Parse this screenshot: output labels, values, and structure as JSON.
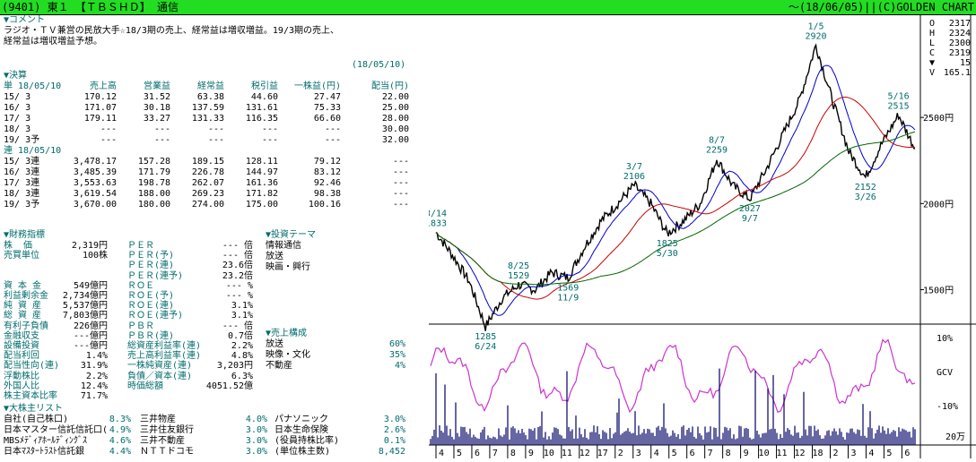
{
  "header": {
    "left": "(9401) 東１ 【ＴＢＳＨＤ】 通信",
    "right": "～(18/06/05)||(C)GOLDEN CHART"
  },
  "comment": {
    "title": "▼コメント",
    "text": [
      "ラジオ・ＴＶ兼営の民放大手☆18/3期の売上、経常益は増収増益。19/3期の売上、",
      "経常益は増収増益予想。"
    ],
    "date": "(18/05/10)"
  },
  "settlement": {
    "title": "▼決算",
    "header": [
      "単 18/05/10",
      "売上高",
      "営業益",
      "経常益",
      "税引益",
      "一株益(円)",
      "配当(円)"
    ],
    "rows": [
      [
        "15/ 3",
        "170.12",
        "31.52",
        "63.38",
        "44.60",
        "27.47",
        "22.00"
      ],
      [
        "16/ 3",
        "171.07",
        "30.18",
        "137.59",
        "131.61",
        "75.33",
        "25.00"
      ],
      [
        "17/ 3",
        "179.11",
        "33.27",
        "131.33",
        "116.35",
        "66.60",
        "28.00"
      ],
      [
        "18/ 3",
        "---",
        "---",
        "---",
        "---",
        "---",
        "30.00"
      ],
      [
        "19/ 3予",
        "---",
        "---",
        "---",
        "---",
        "---",
        "32.00"
      ]
    ],
    "consol_header": "連 18/05/10",
    "consol_rows": [
      [
        "15/ 3連",
        "3,478.17",
        "157.28",
        "189.15",
        "128.11",
        "79.12",
        "---"
      ],
      [
        "16/ 3連",
        "3,485.39",
        "171.79",
        "226.78",
        "144.97",
        "83.12",
        "---"
      ],
      [
        "17/ 3連",
        "3,553.63",
        "198.78",
        "262.07",
        "161.36",
        "92.46",
        "---"
      ],
      [
        "18/ 3連",
        "3,619.54",
        "188.00",
        "269.23",
        "171.82",
        "98.38",
        "---"
      ],
      [
        "19/ 3予",
        "3,670.00",
        "180.00",
        "274.00",
        "175.00",
        "100.16",
        "---"
      ]
    ]
  },
  "financial": {
    "title": "▼財務指標",
    "left": [
      [
        "株  価",
        "2,319円"
      ],
      [
        "売買単位",
        "100株"
      ],
      [
        "",
        ""
      ],
      [
        "",
        ""
      ],
      [
        "資 本 金",
        "549億円"
      ],
      [
        "利益剰余金",
        "2,734億円"
      ],
      [
        "純 資 産",
        "5,537億円"
      ],
      [
        "総 資 産",
        "7,803億円"
      ],
      [
        "有利子負債",
        "226億円"
      ],
      [
        "金融収支",
        "---億円"
      ],
      [
        "設備投資",
        "---億円"
      ],
      [
        "配当利回",
        "1.4%"
      ],
      [
        "配当性向(連)",
        "31.9%"
      ],
      [
        "浮動株比",
        "2.2%"
      ],
      [
        "外国人比",
        "12.4%"
      ],
      [
        "株主資本比率",
        "71.7%"
      ]
    ],
    "mid": [
      [
        "ＰＥＲ",
        "--- 倍"
      ],
      [
        "ＰＥＲ(予)",
        "--- 倍"
      ],
      [
        "ＰＥＲ(連)",
        "23.6倍"
      ],
      [
        "ＰＥＲ(連予)",
        "23.2倍"
      ],
      [
        "ＲＯＥ",
        "--- %"
      ],
      [
        "ＲＯＥ(予)",
        "--- %"
      ],
      [
        "ＲＯＥ(連)",
        "3.1%"
      ],
      [
        "ＲＯＥ(連予)",
        "3.1%"
      ],
      [
        "ＰＢＲ",
        "--- 倍"
      ],
      [
        "ＰＢＲ(連)",
        "0.7倍"
      ],
      [
        "総資産利益率(連)",
        "2.2%"
      ],
      [
        "売上高利益率(連)",
        "4.8%"
      ],
      [
        "一株純資産(連)",
        "3,203円"
      ],
      [
        "負債／資本(連)",
        "6.3%"
      ],
      [
        "時価総額",
        "4051.52億"
      ]
    ]
  },
  "theme": {
    "title": "▼投資テーマ",
    "items": [
      "情報通信",
      "放送",
      "映画・興行"
    ]
  },
  "composition": {
    "title": "▼売上構成",
    "items": [
      [
        "放送",
        "60%"
      ],
      [
        "映像・文化",
        "35%"
      ],
      [
        "不動産",
        "4%"
      ]
    ]
  },
  "shareholders": {
    "title": "▼大株主リスト",
    "rows": [
      [
        "自社(自己株口)",
        "8.3%",
        "三井物産",
        "4.0%",
        "パナソニック",
        "3.0%"
      ],
      [
        "日本マスター信託信託口(",
        "4.9%",
        "三井住友銀行",
        "3.0%",
        "日本生命保険",
        "2.6%"
      ],
      [
        "MBSﾒﾃﾞｨｱﾎｰﾙﾃﾞｨﾝｸﾞｽ",
        "4.6%",
        "三井不動産",
        "3.0%",
        "(役員持株比率)",
        "0.1%"
      ],
      [
        "日本ﾏｽﾀｰﾄﾗｽﾄ信託銀",
        "4.4%",
        "ＮＴＴドコモ",
        "3.0%",
        "(単位株主数)",
        "8,452"
      ]
    ]
  },
  "ohlc": {
    "labels": [
      "O",
      "H",
      "L",
      "C",
      "▼",
      "V"
    ],
    "values": [
      "2317",
      "2324",
      "2300",
      "2319",
      "15",
      "165.1"
    ]
  },
  "chart_data": {
    "type": "line",
    "x": [
      "16/3/14",
      "16/4/15",
      "16/5/10",
      "16/6/24",
      "16/7/20",
      "16/8/25",
      "16/9/15",
      "16/10/10",
      "16/11/9",
      "16/12/10",
      "17/1/10",
      "17/2/10",
      "17/3/7",
      "17/4/10",
      "17/5/30",
      "17/6/20",
      "17/7/15",
      "17/8/7",
      "17/8/30",
      "17/9/7",
      "17/10/10",
      "17/11/10",
      "17/12/10",
      "18/1/5",
      "18/2/5",
      "18/3/5",
      "18/3/26",
      "18/4/15",
      "18/5/16",
      "18/6/5"
    ],
    "series": [
      {
        "values": [
          1833,
          1700,
          1550,
          1285,
          1450,
          1529,
          1500,
          1600,
          1569,
          1750,
          1900,
          2000,
          2106,
          2000,
          1825,
          1900,
          2000,
          2259,
          2100,
          2027,
          2200,
          2400,
          2600,
          2920,
          2600,
          2300,
          2152,
          2350,
          2515,
          2319
        ]
      }
    ],
    "annotations": [
      {
        "date": "3/14",
        "value": "1833"
      },
      {
        "date": "6/24",
        "value": "1285"
      },
      {
        "date": "8/25",
        "value": "1529"
      },
      {
        "date": "11/9",
        "value": "1569"
      },
      {
        "date": "3/7",
        "value": "2106"
      },
      {
        "date": "5/30",
        "value": "1825"
      },
      {
        "date": "8/7",
        "value": "2259"
      },
      {
        "date": "9/7",
        "value": "2027"
      },
      {
        "date": "1/5",
        "value": "2920"
      },
      {
        "date": "3/26",
        "value": "2152"
      },
      {
        "date": "5/16",
        "value": "2515"
      }
    ],
    "ylim": [
      1300,
      3000
    ],
    "y_ticks": [
      "2500円",
      "2000円",
      "1500円"
    ],
    "osc_ticks": [
      "10%",
      "GCV",
      "-10%"
    ],
    "volume_label": "20万",
    "month_ticks": [
      "4",
      "5",
      "6",
      "7",
      "8",
      "9",
      "10",
      "11",
      "12",
      "17",
      "2",
      "3",
      "4",
      "5",
      "6",
      "7",
      "8",
      "9",
      "10",
      "11",
      "12",
      "18",
      "2",
      "3",
      "4",
      "5",
      "6"
    ],
    "colors": {
      "price": "#000000",
      "ma_short": "#0000cc",
      "ma_mid": "#cc0000",
      "ma_long": "#006600",
      "osc": "#cc33cc",
      "volume": "#000066",
      "title_bg": "#22dd22"
    }
  }
}
